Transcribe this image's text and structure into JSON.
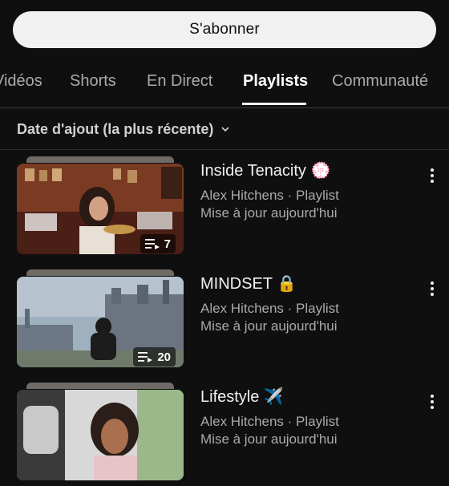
{
  "subscribe_label": "S'abonner",
  "tabs": [
    {
      "label": "Vidéos"
    },
    {
      "label": "Shorts"
    },
    {
      "label": "En Direct"
    },
    {
      "label": "Playlists",
      "active": true
    },
    {
      "label": "Communauté"
    }
  ],
  "sort": {
    "label": "Date d'ajout (la plus récente)",
    "icon": "chevron-down-icon"
  },
  "playlists": [
    {
      "title": "Inside Tenacity 💮",
      "channel": "Alex Hitchens · Playlist",
      "updated": "Mise à jour aujourd'hui",
      "count": "7"
    },
    {
      "title": "MINDSET 🔒",
      "channel": "Alex Hitchens · Playlist",
      "updated": "Mise à jour aujourd'hui",
      "count": "20"
    },
    {
      "title": "Lifestyle ✈️",
      "channel": "Alex Hitchens · Playlist",
      "updated": "Mise à jour aujourd'hui",
      "count": ""
    }
  ],
  "colors": {
    "background": "#0f0f0f",
    "primary_text": "#f1f1f1",
    "secondary_text": "#aaaaaa",
    "button_bg": "#f1f1f1"
  }
}
